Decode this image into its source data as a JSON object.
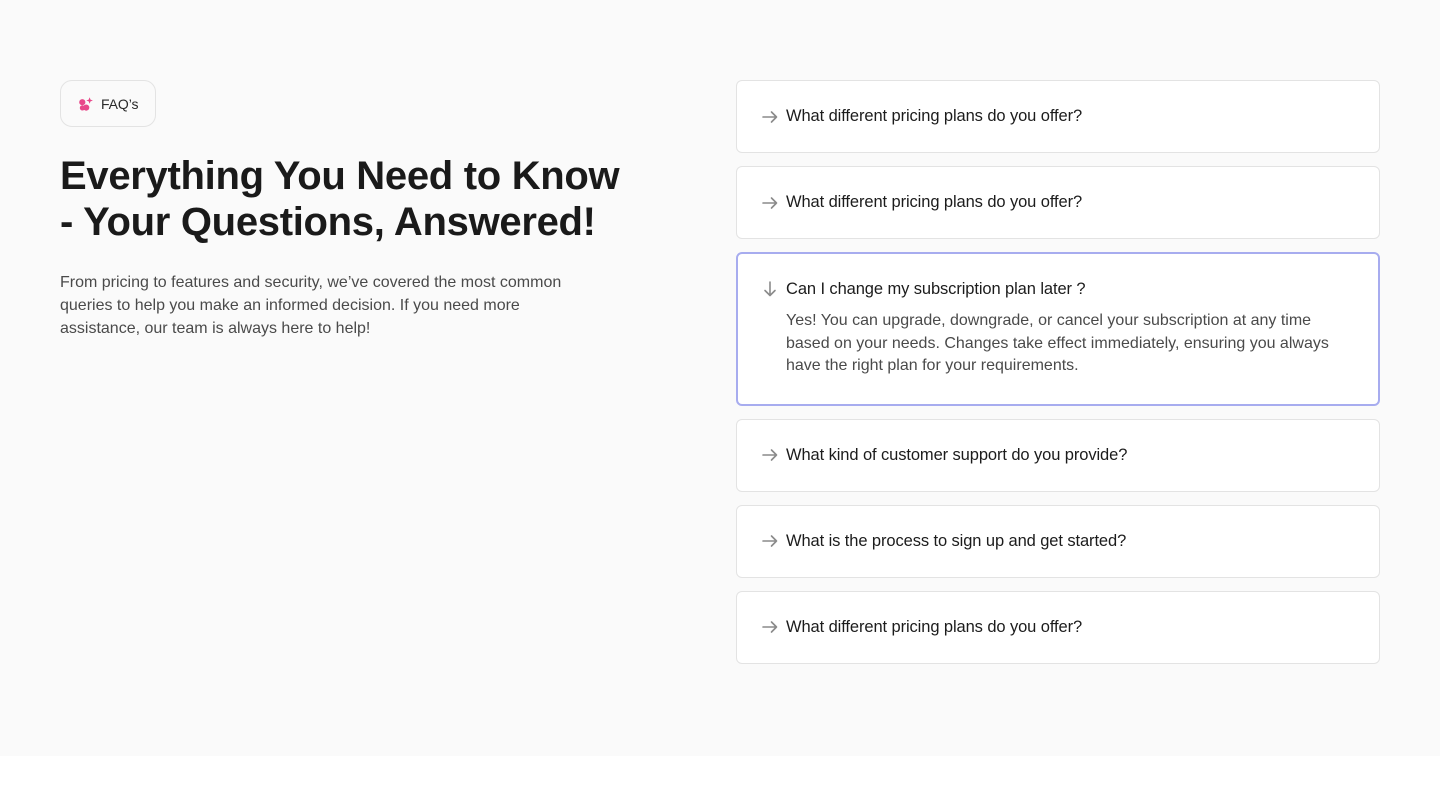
{
  "badge": {
    "icon": "sparkle-dots-icon",
    "label": "FAQ’s",
    "accent_color": "#e8488a"
  },
  "headline": "Everything You Need to Know\n- Your Questions, Answered!",
  "intro": "From pricing to features and security, we’ve covered the most common queries to help you make an informed decision. If you need more assistance, our team is always here to help!",
  "faq": {
    "open_border_color": "#a7acef",
    "collapsed_icon": "arrow-right-icon",
    "expanded_icon": "arrow-down-icon",
    "items": [
      {
        "question": "What different pricing plans do you offer?",
        "open": false
      },
      {
        "question": "What different pricing plans do you offer?",
        "open": false
      },
      {
        "question": "Can I change my subscription plan later ?",
        "open": true,
        "answer": "Yes! You can upgrade, downgrade, or cancel your subscription at any time based on your needs. Changes take effect immediately, ensuring you always have the right plan for your requirements."
      },
      {
        "question": "What kind of customer support do you provide?",
        "open": false
      },
      {
        "question": "What is the process to sign up and get started?",
        "open": false
      },
      {
        "question": "What different pricing plans do you offer?",
        "open": false
      }
    ]
  }
}
